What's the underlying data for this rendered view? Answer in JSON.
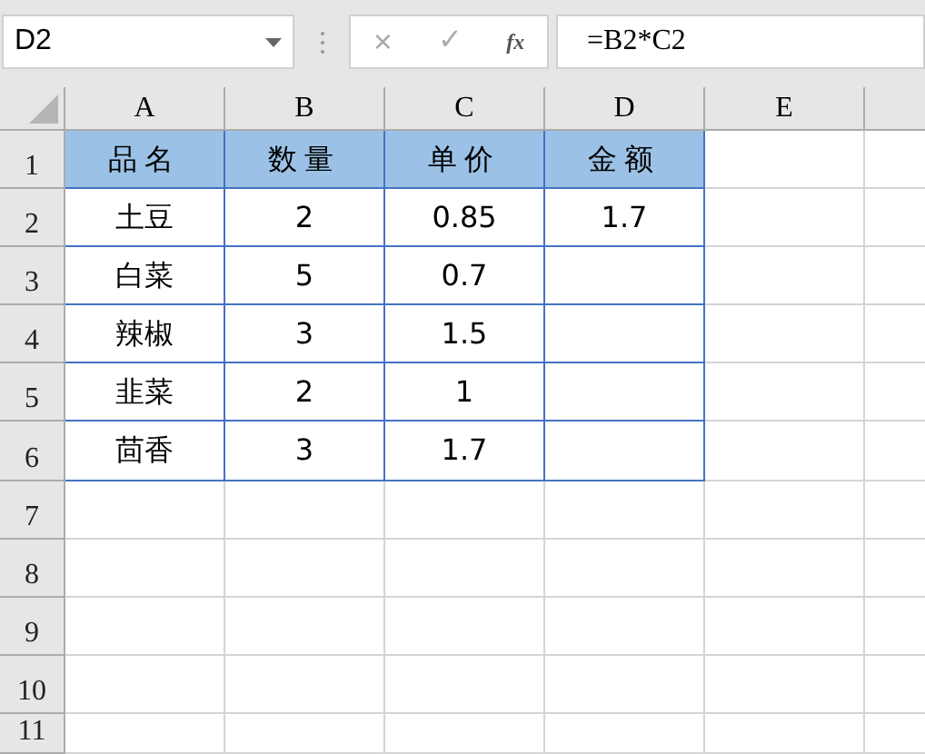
{
  "name_box": {
    "value": "D2"
  },
  "formula_bar": {
    "cancel_symbol": "×",
    "enter_symbol": "✓",
    "function_symbol": "fx",
    "value": "=B2*C2"
  },
  "column_headers": [
    "A",
    "B",
    "C",
    "D",
    "E"
  ],
  "row_headers": [
    "1",
    "2",
    "3",
    "4",
    "5",
    "6",
    "7",
    "8",
    "9",
    "10",
    "11"
  ],
  "table": {
    "columns": [
      "品名",
      "数量",
      "单价",
      "金额"
    ],
    "rows": [
      [
        "土豆",
        "2",
        "0.85",
        "1.7"
      ],
      [
        "白菜",
        "5",
        "0.7",
        ""
      ],
      [
        "辣椒",
        "3",
        "1.5",
        ""
      ],
      [
        "韭菜",
        "2",
        "1",
        ""
      ],
      [
        "茴香",
        "3",
        "1.7",
        ""
      ]
    ]
  }
}
